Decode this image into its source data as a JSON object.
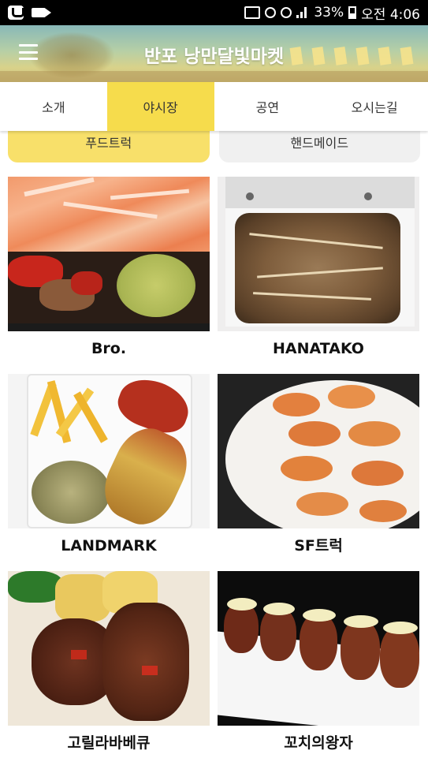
{
  "status_bar": {
    "battery": "33%",
    "time": "오전 4:06"
  },
  "header": {
    "title": "반포 낭만달빛마켓"
  },
  "tabs": [
    {
      "label": "소개",
      "active": false
    },
    {
      "label": "야시장",
      "active": true
    },
    {
      "label": "공연",
      "active": false
    },
    {
      "label": "오시는길",
      "active": false
    }
  ],
  "subcategories": [
    {
      "label": "푸드트럭",
      "active": true
    },
    {
      "label": "핸드메이드",
      "active": false
    }
  ],
  "vendors": [
    {
      "name": "Bro."
    },
    {
      "name": "HANATAKO"
    },
    {
      "name": "LANDMARK"
    },
    {
      "name": "SF트럭"
    },
    {
      "name": "고릴라바베큐"
    },
    {
      "name": "꼬치의왕자"
    }
  ],
  "colors": {
    "accent_yellow": "#f6dc4c",
    "header_top": "#88b8b8"
  }
}
